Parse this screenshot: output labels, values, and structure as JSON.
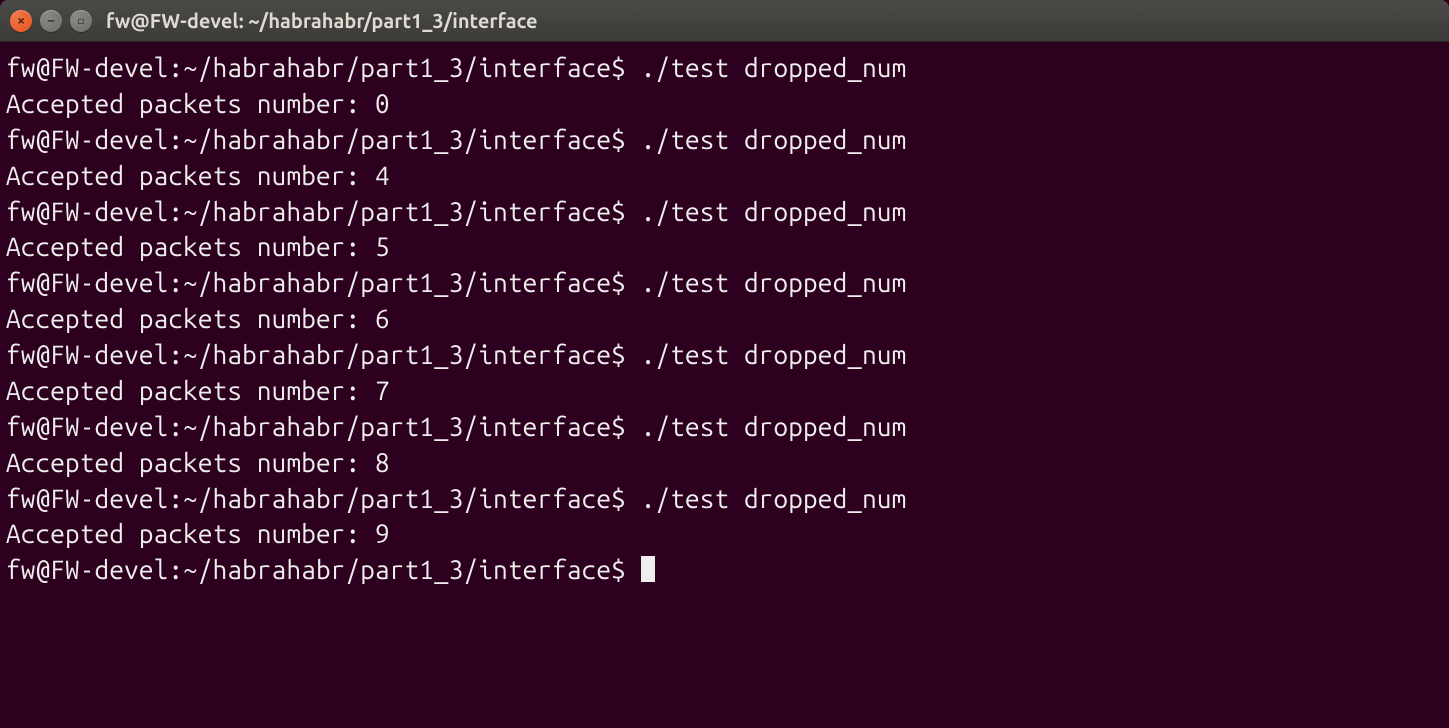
{
  "window": {
    "title": "fw@FW-devel: ~/habrahabr/part1_3/interface"
  },
  "terminal": {
    "prompt": "fw@FW-devel:~/habrahabr/part1_3/interface$ ",
    "command": "./test dropped_num",
    "output_prefix": "Accepted packets number: ",
    "runs": [
      {
        "value": "0"
      },
      {
        "value": "4"
      },
      {
        "value": "5"
      },
      {
        "value": "6"
      },
      {
        "value": "7"
      },
      {
        "value": "8"
      },
      {
        "value": "9"
      }
    ]
  }
}
